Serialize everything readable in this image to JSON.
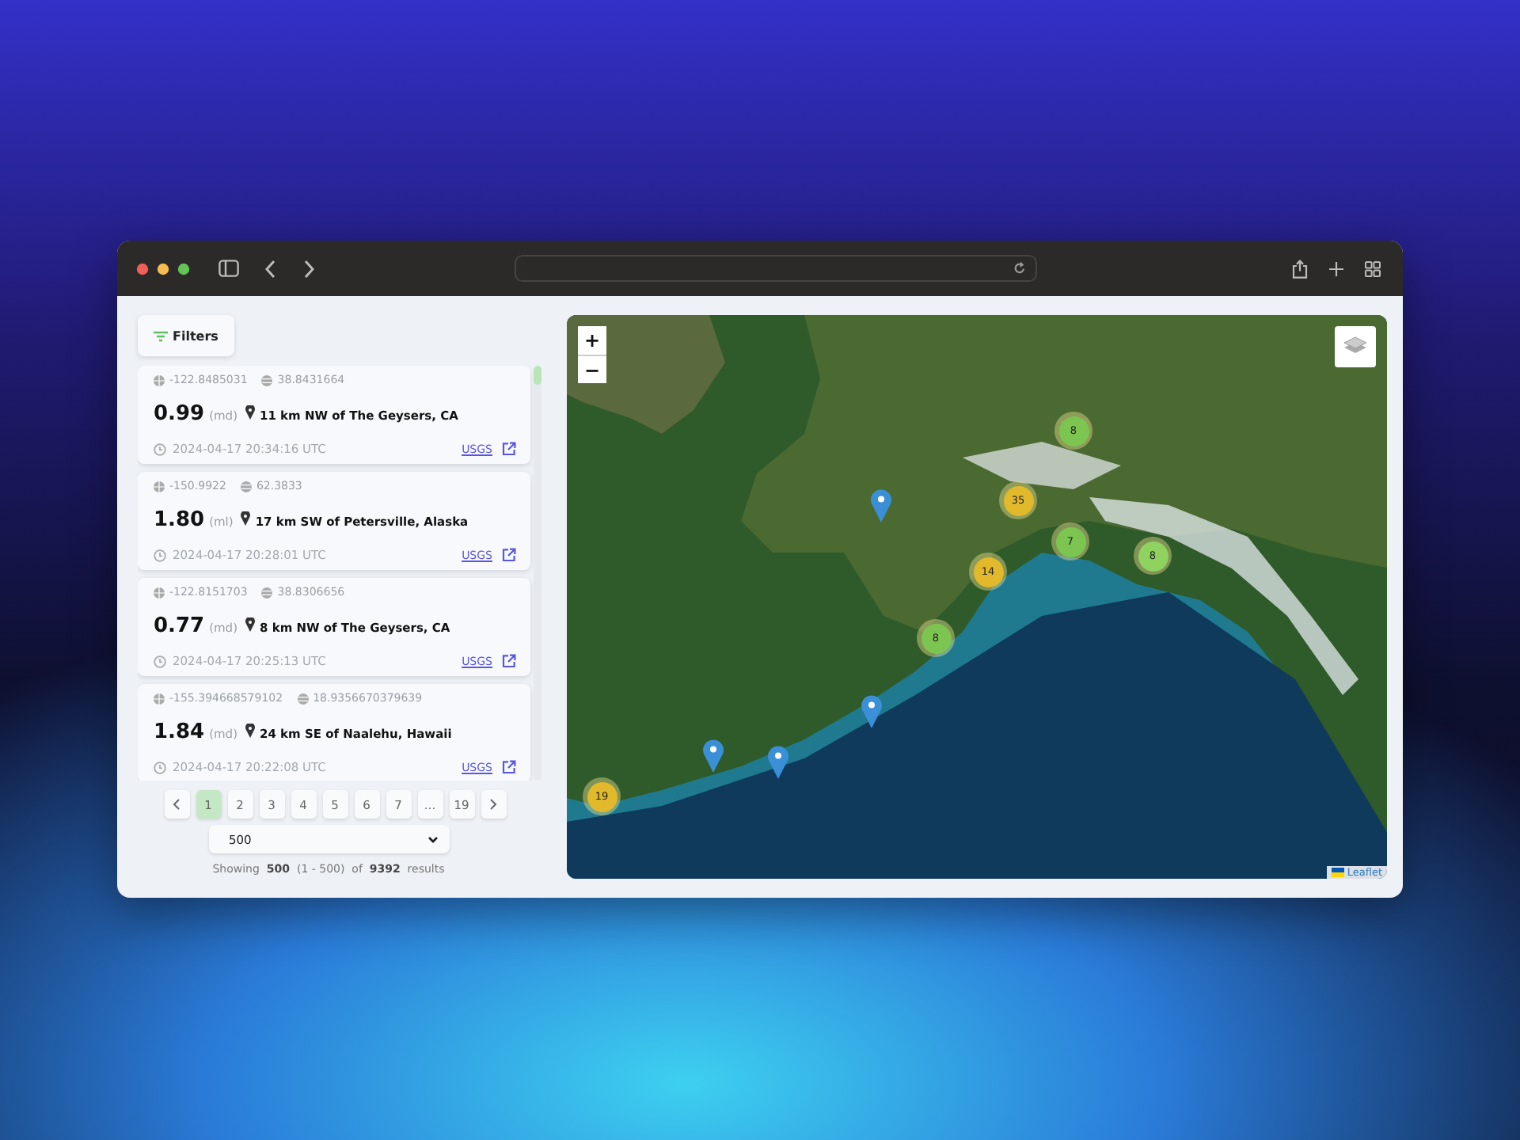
{
  "filters_button": {
    "label": "Filters"
  },
  "earthquakes": [
    {
      "longitude": "-122.8485031",
      "latitude": "38.8431664",
      "magnitude": "0.99",
      "mag_type": "(md)",
      "place": "11 km NW of The Geysers, CA",
      "time": "2024-04-17 20:34:16 UTC",
      "link": "USGS"
    },
    {
      "longitude": "-150.9922",
      "latitude": "62.3833",
      "magnitude": "1.80",
      "mag_type": "(ml)",
      "place": "17 km SW of Petersville, Alaska",
      "time": "2024-04-17 20:28:01 UTC",
      "link": "USGS"
    },
    {
      "longitude": "-122.8151703",
      "latitude": "38.8306656",
      "magnitude": "0.77",
      "mag_type": "(md)",
      "place": "8 km NW of The Geysers, CA",
      "time": "2024-04-17 20:25:13 UTC",
      "link": "USGS"
    },
    {
      "longitude": "-155.394668579102",
      "latitude": "18.9356670379639",
      "magnitude": "1.84",
      "mag_type": "(md)",
      "place": "24 km SE of Naalehu, Hawaii",
      "time": "2024-04-17 20:22:08 UTC",
      "link": "USGS"
    }
  ],
  "pagination": {
    "pages": [
      {
        "label": "1",
        "selected": true
      },
      {
        "label": "2",
        "selected": false
      },
      {
        "label": "3",
        "selected": false
      },
      {
        "label": "4",
        "selected": false
      },
      {
        "label": "5",
        "selected": false
      },
      {
        "label": "6",
        "selected": false
      },
      {
        "label": "7",
        "selected": false
      },
      {
        "label": "...",
        "selected": false
      },
      {
        "label": "19",
        "selected": false
      }
    ],
    "page_size": "500",
    "summary": "Showing  **500**  (1 - 500)  of  **9392**  results"
  },
  "map": {
    "zoom_in": "+",
    "zoom_out": "−",
    "attribution": "Leaflet",
    "markers": [
      {
        "kind": "cluster",
        "count": "8",
        "color": "#7cc550"
      },
      {
        "kind": "cluster",
        "count": "35",
        "color": "#e1b92b"
      },
      {
        "kind": "cluster",
        "count": "7",
        "color": "#7cc550"
      },
      {
        "kind": "cluster",
        "count": "8",
        "color": "#8fd260"
      },
      {
        "kind": "cluster",
        "count": "14",
        "color": "#e1b92b"
      },
      {
        "kind": "cluster",
        "count": "8",
        "color": "#7cc550"
      },
      {
        "kind": "cluster",
        "count": "19",
        "color": "#e1b92b"
      },
      {
        "kind": "pin"
      },
      {
        "kind": "pin"
      },
      {
        "kind": "pin"
      },
      {
        "kind": "pin"
      }
    ]
  }
}
